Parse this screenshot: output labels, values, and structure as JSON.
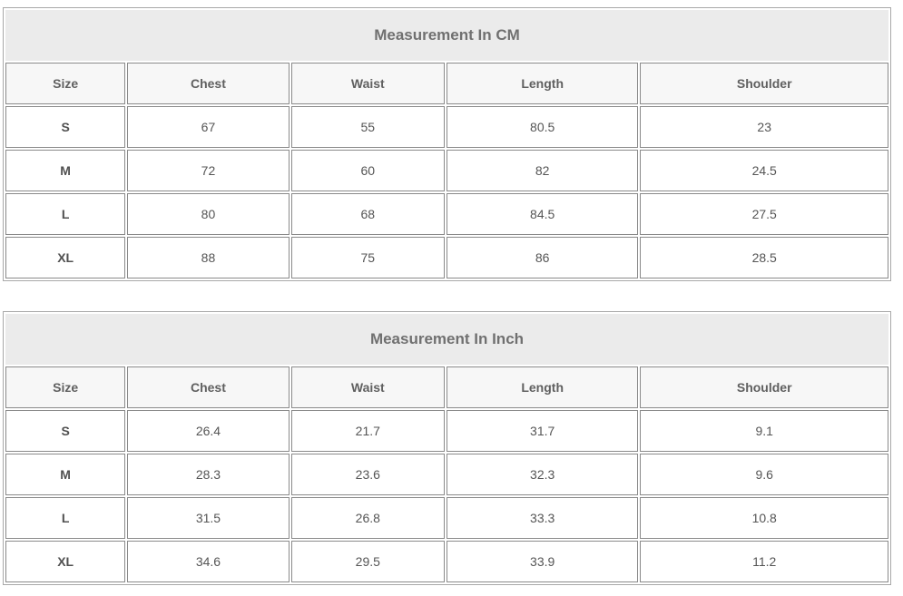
{
  "tables": [
    {
      "id": "table-cm",
      "title": "Measurement In CM",
      "headers": [
        "Size",
        "Chest",
        "Waist",
        "Length",
        "Shoulder"
      ],
      "rows": [
        [
          "S",
          "67",
          "55",
          "80.5",
          "23"
        ],
        [
          "M",
          "72",
          "60",
          "82",
          "24.5"
        ],
        [
          "L",
          "80",
          "68",
          "84.5",
          "27.5"
        ],
        [
          "XL",
          "88",
          "75",
          "86",
          "28.5"
        ]
      ]
    },
    {
      "id": "table-inch",
      "title": "Measurement In Inch",
      "headers": [
        "Size",
        "Chest",
        "Waist",
        "Length",
        "Shoulder"
      ],
      "rows": [
        [
          "S",
          "26.4",
          "21.7",
          "31.7",
          "9.1"
        ],
        [
          "M",
          "28.3",
          "23.6",
          "32.3",
          "9.6"
        ],
        [
          "L",
          "31.5",
          "26.8",
          "33.3",
          "10.8"
        ],
        [
          "XL",
          "34.6",
          "29.5",
          "33.9",
          "11.2"
        ]
      ]
    }
  ]
}
